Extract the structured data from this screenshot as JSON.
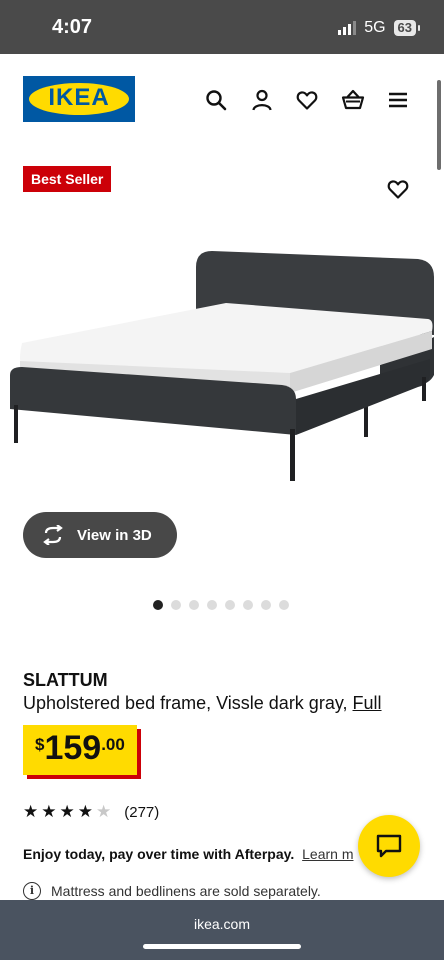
{
  "status_bar": {
    "time": "4:07",
    "network": "5G",
    "battery": "63"
  },
  "header": {
    "logo_text": "IKEA",
    "icons": [
      "search-icon",
      "account-icon",
      "heart-icon",
      "basket-icon",
      "menu-icon"
    ]
  },
  "product": {
    "badge": "Best Seller",
    "name": "SLATTUM",
    "description": "Upholstered bed frame, Vissle dark gray,",
    "size_link": "Full",
    "price": {
      "currency": "$",
      "integer": "159",
      "decimal": ".00"
    },
    "rating": {
      "stars": 4,
      "max": 5,
      "count": "(277)"
    },
    "view_3d_label": "View in 3D",
    "carousel": {
      "total": 8,
      "active": 1
    },
    "afterpay_text": "Enjoy today, pay over time with Afterpay.",
    "afterpay_link": "Learn m",
    "note": "Mattress and bedlinens are sold separately."
  },
  "browser": {
    "url": "ikea.com"
  },
  "colors": {
    "ikea_blue": "#0058a3",
    "ikea_yellow": "#ffdb00",
    "badge_red": "#cc0008",
    "frame_gray": "#3a3d40"
  }
}
